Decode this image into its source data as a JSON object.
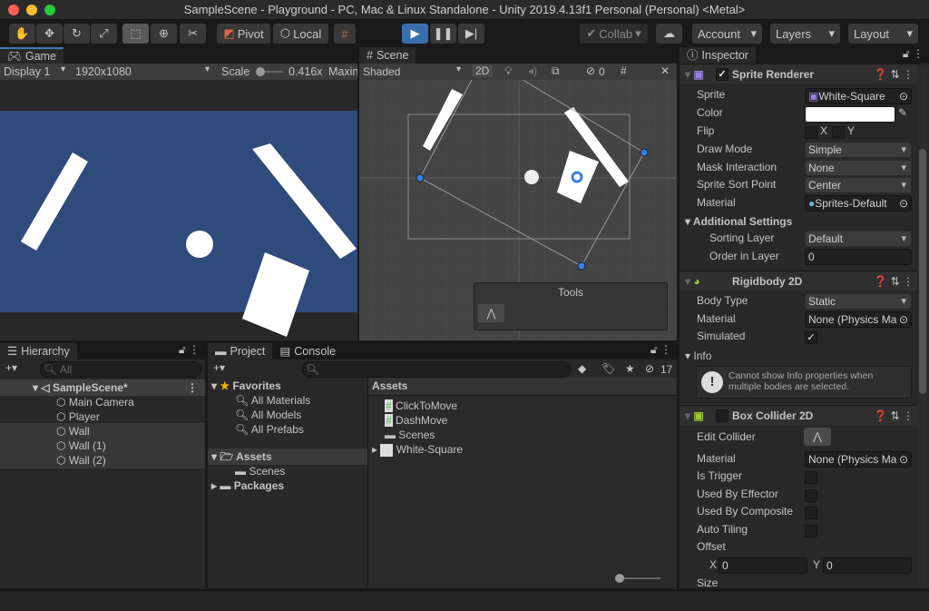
{
  "window": {
    "title": "SampleScene - Playground - PC, Mac & Linux Standalone - Unity 2019.4.13f1 Personal (Personal) <Metal>"
  },
  "toolbar": {
    "pivot": "Pivot",
    "local": "Local",
    "collab": "Collab",
    "account": "Account",
    "layers": "Layers",
    "layout": "Layout"
  },
  "game": {
    "tab": "Game",
    "display": "Display 1",
    "resolution": "1920x1080",
    "scale_label": "Scale",
    "scale_value": "0.416x",
    "maximize": "Maxin",
    "background": "#2f4b7b"
  },
  "scene": {
    "tab": "Scene",
    "shading": "Shaded",
    "mode_2d": "2D",
    "hidden_count": "0",
    "tools_title": "Tools"
  },
  "hierarchy": {
    "tab": "Hierarchy",
    "search_placeholder": "All",
    "scene": "SampleScene*",
    "items": [
      "Main Camera",
      "Player",
      "Wall",
      "Wall (1)",
      "Wall (2)"
    ]
  },
  "project": {
    "tab": "Project",
    "console_tab": "Console",
    "hidden_count": "17",
    "favorites": "Favorites",
    "fav_items": [
      "All Materials",
      "All Models",
      "All Prefabs"
    ],
    "assets": "Assets",
    "assets_children": [
      "Scenes"
    ],
    "packages": "Packages",
    "assets_header": "Assets",
    "asset_items": [
      "ClickToMove",
      "DashMove",
      "Scenes",
      "White-Square"
    ]
  },
  "inspector": {
    "tab": "Inspector",
    "sprite_renderer": {
      "title": "Sprite Renderer",
      "sprite_label": "Sprite",
      "sprite": "White-Square",
      "color_label": "Color",
      "flip_label": "Flip",
      "flip_x": "X",
      "flip_y": "Y",
      "draw_mode_label": "Draw Mode",
      "draw_mode": "Simple",
      "mask_label": "Mask Interaction",
      "mask": "None",
      "sort_point_label": "Sprite Sort Point",
      "sort_point": "Center",
      "material_label": "Material",
      "material": "Sprites-Default",
      "additional": "Additional Settings",
      "sorting_layer_label": "Sorting Layer",
      "sorting_layer": "Default",
      "order_label": "Order in Layer",
      "order": "0"
    },
    "rigidbody": {
      "title": "Rigidbody 2D",
      "body_type_label": "Body Type",
      "body_type": "Static",
      "material_label": "Material",
      "material": "None (Physics Ma",
      "simulated_label": "Simulated",
      "info_label": "Info",
      "info_message": "Cannot show Info properties when multiple bodies are selected."
    },
    "box_collider": {
      "title": "Box Collider 2D",
      "edit_label": "Edit Collider",
      "material_label": "Material",
      "material": "None (Physics Ma",
      "is_trigger": "Is Trigger",
      "used_by_effector": "Used By Effector",
      "used_by_composite": "Used By Composite",
      "auto_tiling": "Auto Tiling",
      "offset_label": "Offset",
      "offset_x_label": "X",
      "offset_x": "0",
      "offset_y_label": "Y",
      "offset_y": "0",
      "size_label": "Size"
    }
  }
}
